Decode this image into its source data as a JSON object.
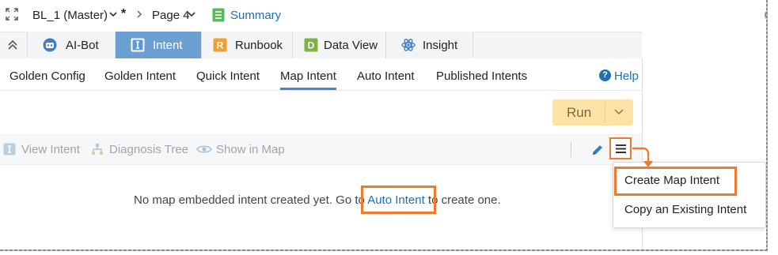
{
  "topbar": {
    "document": "BL_1 (Master)",
    "modified_marker": "*",
    "page": "Page 4",
    "summary": "Summary"
  },
  "module_tabs": [
    {
      "label": "AI-Bot",
      "icon": "robot-icon",
      "color": "#4a86c5"
    },
    {
      "label": "Intent",
      "icon": "intent-icon",
      "color": "#5b9bd5",
      "active": true
    },
    {
      "label": "Runbook",
      "icon": "runbook-icon",
      "color": "#f0a030"
    },
    {
      "label": "Data View",
      "icon": "dataview-icon",
      "color": "#7cb342"
    },
    {
      "label": "Insight",
      "icon": "atom-icon",
      "color": "#4a86c5"
    }
  ],
  "sub_tabs": [
    {
      "label": "Golden Config"
    },
    {
      "label": "Golden Intent"
    },
    {
      "label": "Quick Intent"
    },
    {
      "label": "Map Intent",
      "active": true
    },
    {
      "label": "Auto Intent"
    },
    {
      "label": "Published Intents"
    }
  ],
  "help": "Help",
  "run_button": "Run",
  "actions": {
    "view_intent": "View Intent",
    "diagnosis_tree": "Diagnosis Tree",
    "show_in_map": "Show in Map"
  },
  "empty_state": {
    "before": "No map embedded intent created yet. Go to ",
    "link": "Auto Intent",
    "after": " to create one."
  },
  "menu": {
    "items": [
      "Create Map Intent",
      "Copy an Existing Intent"
    ]
  },
  "colors": {
    "accent": "#1e6fb5",
    "active_tab": "#6c9fd1",
    "highlight": "#ef7a2f",
    "run_button": "#fbe3a6"
  }
}
